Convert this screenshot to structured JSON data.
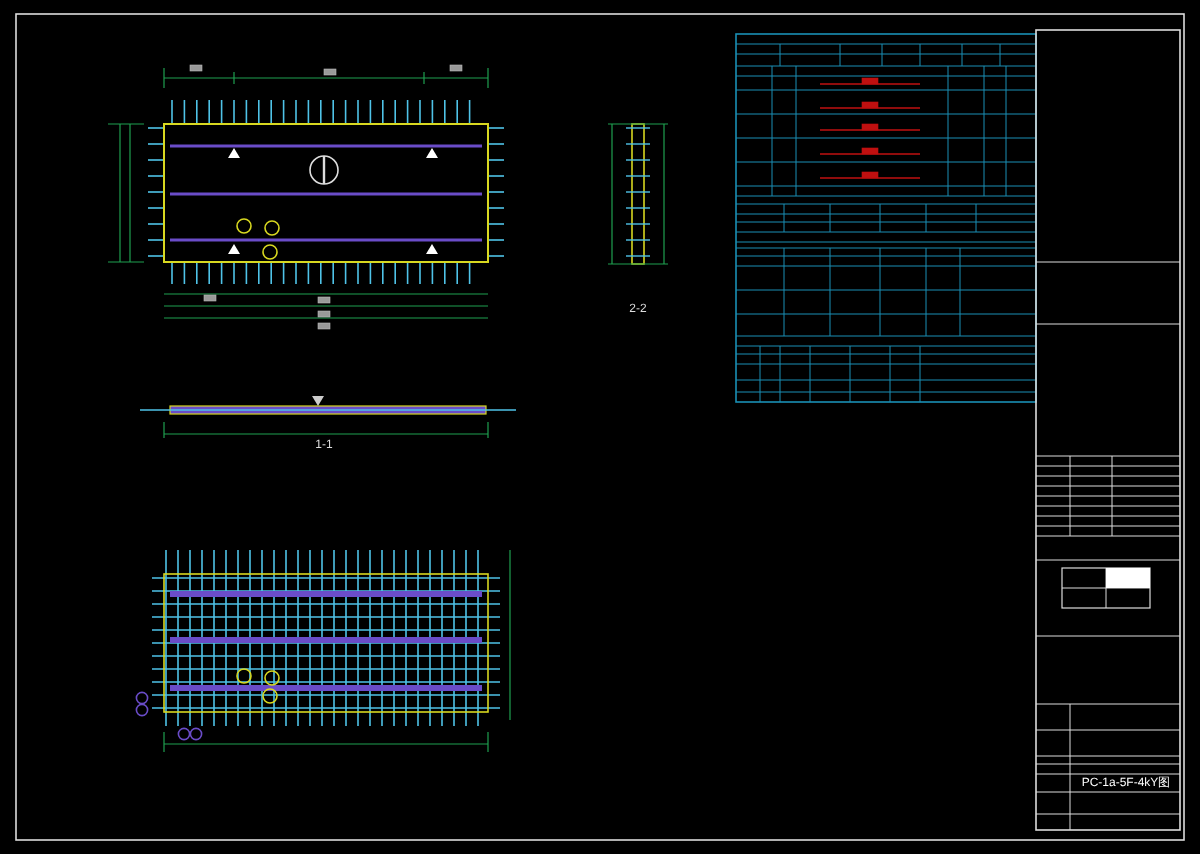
{
  "drawing": {
    "section_labels": [
      {
        "text": "1-1"
      },
      {
        "text": "2-2"
      }
    ],
    "title_block": {
      "drawing_number": "PC-1a-5F-4kY图"
    }
  }
}
